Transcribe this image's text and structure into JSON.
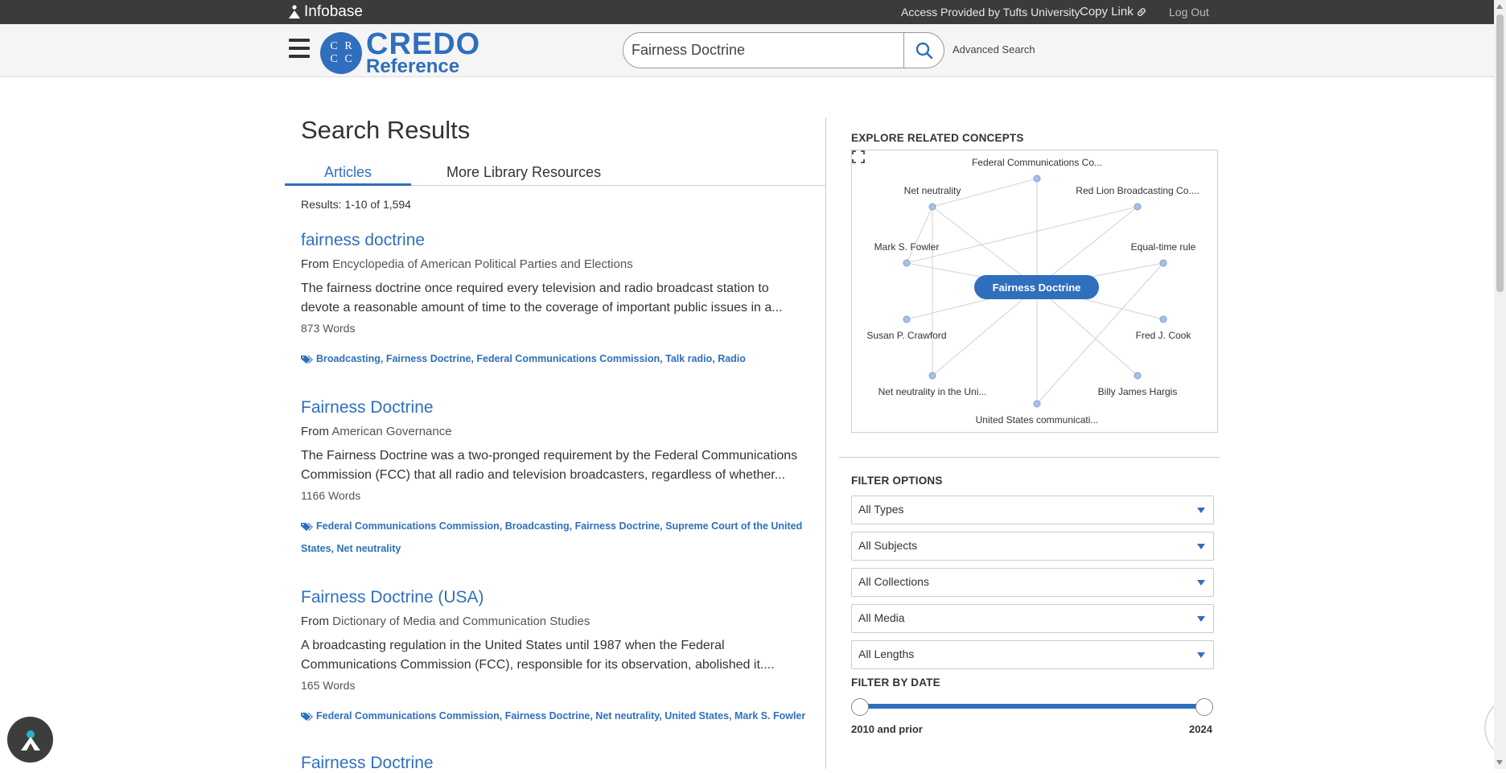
{
  "topbar": {
    "brand": "Infobase",
    "access": "Access Provided by Tufts University",
    "copy_link": "Copy Link",
    "logout": "Log Out"
  },
  "header": {
    "logo_letters": [
      "C",
      "R",
      "C",
      "C"
    ],
    "logo_line1": "CREDO",
    "logo_line2": "Reference",
    "search_value": "Fairness Doctrine",
    "advanced_search": "Advanced Search"
  },
  "results": {
    "heading": "Search Results",
    "tabs": [
      "Articles",
      "More Library Resources"
    ],
    "count": "Results: 1-10 of 1,594",
    "from_label": "From",
    "items": [
      {
        "title": "fairness doctrine",
        "source": "Encyclopedia of American Political Parties and Elections",
        "desc_line1": "The fairness doctrine once required every television and radio broadcast station to",
        "desc_line2": "devote a reasonable amount of time to the coverage of important public issues in a...",
        "words": "873 Words",
        "tags_line1": "Broadcasting, Fairness Doctrine, Federal Communications Commission, Talk radio, Radio",
        "tags_line2": ""
      },
      {
        "title": "Fairness Doctrine",
        "source": "American Governance",
        "desc_line1": "The Fairness Doctrine was a two-pronged requirement by the Federal Communications",
        "desc_line2": "Commission (FCC) that all radio and television broadcasters, regardless of whether...",
        "words": "1166 Words",
        "tags_line1": "Federal Communications Commission, Broadcasting, Fairness Doctrine, Supreme Court of the United",
        "tags_line2": "States, Net neutrality"
      },
      {
        "title": "Fairness Doctrine (USA)",
        "source": "Dictionary of Media and Communication Studies",
        "desc_line1": "A broadcasting regulation in the United States until 1987 when the Federal",
        "desc_line2": "Communications Commission (FCC), responsible for its observation, abolished it....",
        "words": "165 Words",
        "tags_line1": "Federal Communications Commission, Fairness Doctrine, Net neutrality, United States, Mark S. Fowler",
        "tags_line2": ""
      },
      {
        "title": "Fairness Doctrine"
      }
    ]
  },
  "sidebar": {
    "explore_title": "EXPLORE RELATED CONCEPTS",
    "concept_center": "Fairness Doctrine",
    "concepts": [
      "Federal Communications Co...",
      "Net neutrality",
      "Red Lion Broadcasting Co....",
      "Mark S. Fowler",
      "Equal-time rule",
      "Susan P. Crawford",
      "Fred J. Cook",
      "Net neutrality in the Uni...",
      "Billy James Hargis",
      "United States communicati..."
    ],
    "filter_title": "FILTER OPTIONS",
    "filters": [
      "All Types",
      "All Subjects",
      "All Collections",
      "All Media",
      "All Lengths"
    ],
    "date_title": "FILTER BY DATE",
    "date_from": "2010 and prior",
    "date_to": "2024"
  },
  "colors": {
    "accent": "#2f6fbd",
    "topbar": "#3b3b3b"
  }
}
